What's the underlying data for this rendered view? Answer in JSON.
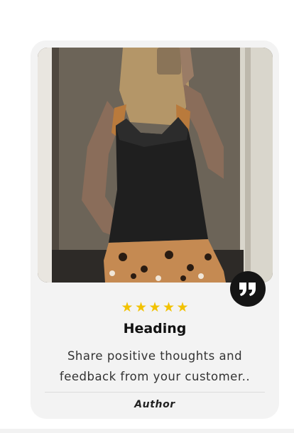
{
  "testimonial": {
    "rating_stars": [
      "★",
      "★",
      "★",
      "★",
      "★"
    ],
    "rating": 5,
    "heading": "Heading",
    "body": "Share positive thoughts and feedback from your customer..",
    "author": "Author",
    "quote_icon": "quote-icon",
    "photo_icon": "customer-photo",
    "star_color": "#f2c200",
    "card_background": "#f3f3f3"
  }
}
